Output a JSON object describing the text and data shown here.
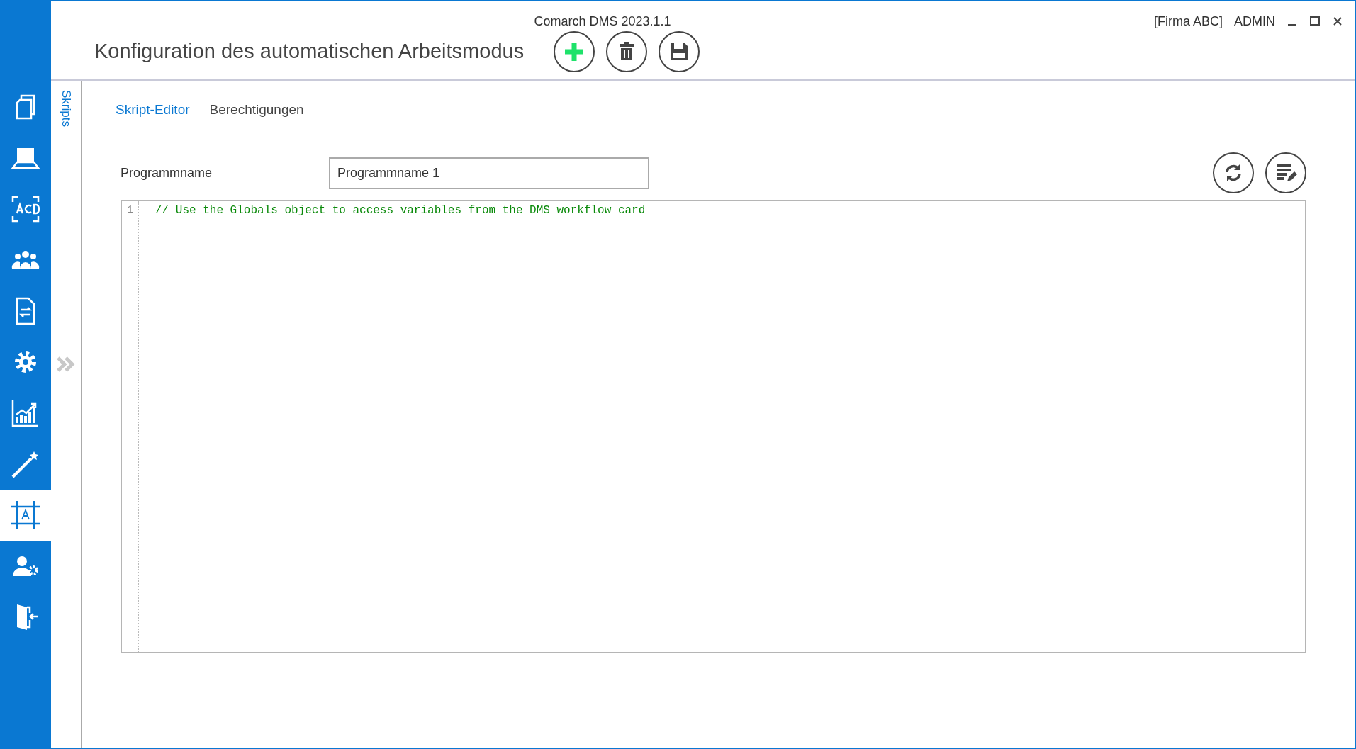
{
  "window": {
    "title": "Comarch DMS 2023.1.1",
    "company": "[Firma ABC]",
    "user": "ADMIN"
  },
  "sidebar": {
    "items": [
      {
        "kind": "documents",
        "selected": false
      },
      {
        "kind": "scanner",
        "selected": false
      },
      {
        "kind": "ocr",
        "selected": false
      },
      {
        "kind": "users",
        "selected": false
      },
      {
        "kind": "workflow",
        "selected": false
      },
      {
        "kind": "settings",
        "selected": false
      },
      {
        "kind": "reports",
        "selected": false
      },
      {
        "kind": "wizard",
        "selected": false
      },
      {
        "kind": "designer",
        "selected": true
      },
      {
        "kind": "user-settings",
        "selected": false
      },
      {
        "kind": "logout",
        "selected": false
      }
    ]
  },
  "header": {
    "title": "Konfiguration des automatischen Arbeitsmodus",
    "toolbar": [
      {
        "kind": "add"
      },
      {
        "kind": "delete"
      },
      {
        "kind": "save"
      }
    ]
  },
  "side_panel": {
    "label": "Skripts"
  },
  "tabs": [
    {
      "label": "Skript-Editor",
      "selected": true
    },
    {
      "label": "Berechtigungen",
      "selected": false
    }
  ],
  "form": {
    "label": "Programmname",
    "value": "Programmname 1",
    "tools": [
      {
        "kind": "refresh"
      },
      {
        "kind": "format"
      }
    ]
  },
  "editor": {
    "lines": [
      {
        "number": "1",
        "text": "// Use the Globals object to access variables from the DMS workflow card"
      }
    ]
  }
}
